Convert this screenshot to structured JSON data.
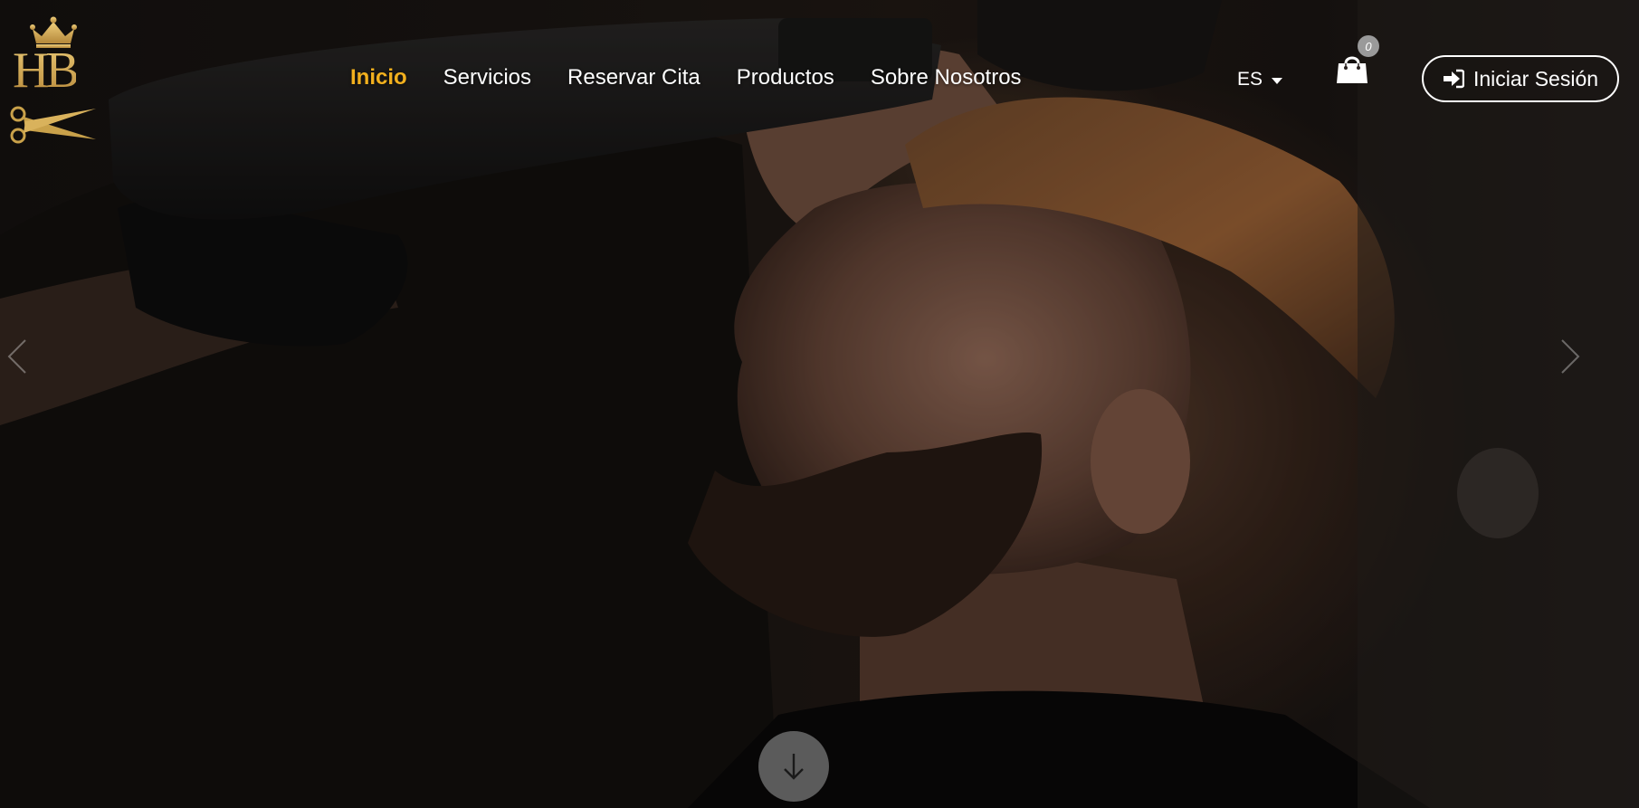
{
  "brand": {
    "monogram": "HB",
    "logo_icons": [
      "crown-icon",
      "scissors-icon"
    ],
    "gold": "#c9a14a"
  },
  "nav": {
    "items": [
      {
        "label": "Inicio",
        "active": true
      },
      {
        "label": "Servicios",
        "active": false
      },
      {
        "label": "Reservar Cita",
        "active": false
      },
      {
        "label": "Productos",
        "active": false
      },
      {
        "label": "Sobre Nosotros",
        "active": false
      }
    ],
    "active_color": "#f2b01e"
  },
  "language": {
    "selected": "ES"
  },
  "cart": {
    "icon": "shopping-bag-icon",
    "count": "0"
  },
  "login": {
    "label": "Iniciar Sesión",
    "icon": "sign-in-icon"
  },
  "carousel": {
    "prev_icon": "chevron-left-icon",
    "next_icon": "chevron-right-icon"
  },
  "scroll": {
    "icon": "arrow-down-icon"
  }
}
